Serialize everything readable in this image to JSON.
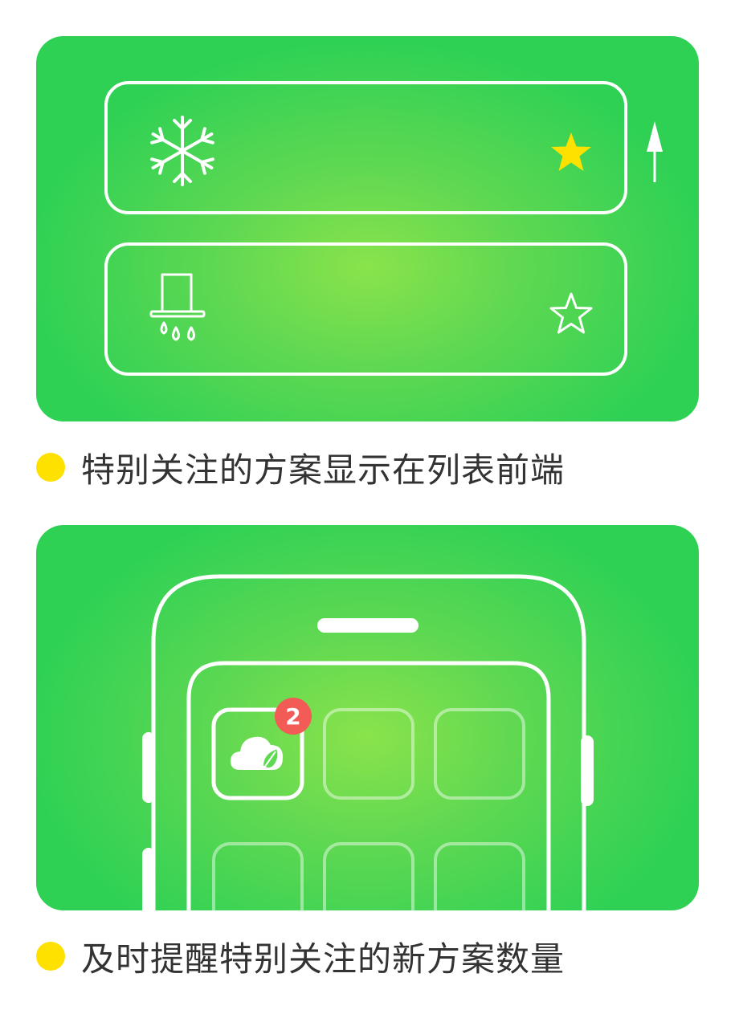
{
  "feature_1": {
    "caption": "特别关注的方案显示在列表前端",
    "cards": [
      {
        "icon": "snowflake-icon",
        "starred": true
      },
      {
        "icon": "range-hood-icon",
        "starred": false
      }
    ],
    "indicator_icon": "up-arrow-icon"
  },
  "feature_2": {
    "caption": "及时提醒特别关注的新方案数量",
    "app_icon": "cloud-leaf-icon",
    "badge_count": "2"
  },
  "colors": {
    "panel_green": "#2fd155",
    "panel_center": "#8ae34b",
    "star_yellow": "#ffe100",
    "bullet_yellow": "#ffe100",
    "badge_red": "#f35b57",
    "caption_text": "#333333"
  }
}
